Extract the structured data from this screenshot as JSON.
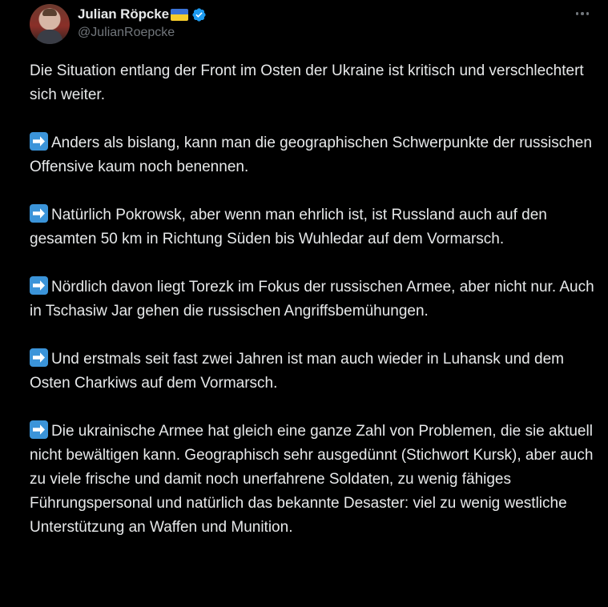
{
  "tweet": {
    "display_name": "Julian Röpcke",
    "handle": "@JulianRoepcke",
    "flag_icon": "ukraine-flag-icon",
    "verified_icon": "verified-badge-icon",
    "verified_color": "#1d9bf0",
    "more_icon": "more-options-icon"
  },
  "content": {
    "intro": "Die Situation entlang der Front im Osten der Ukraine ist kritisch und verschlechtert sich weiter.",
    "points": [
      "Anders als bislang, kann man die geographischen Schwerpunkte der russischen Offensive kaum noch benennen.",
      "Natürlich Pokrowsk, aber wenn man ehrlich ist, ist Russland auch auf den gesamten 50 km in Richtung Süden bis Wuhledar auf dem Vormarsch.",
      "Nördlich davon liegt Torezk im Fokus der russischen Armee, aber nicht nur. Auch in Tschasiw Jar gehen die russischen Angriffsbemühungen.",
      "Und erstmals seit fast zwei Jahren ist man auch wieder in Luhansk und dem Osten Charkiws auf dem Vormarsch.",
      "Die ukrainische Armee hat gleich eine ganze Zahl von Problemen, die sie aktuell nicht bewältigen kann. Geographisch sehr ausgedünnt (Stichwort Kursk), aber auch zu viele frische und damit noch unerfahrene Soldaten, zu wenig fähiges Führungspersonal und natürlich das bekannte Desaster: viel zu wenig westliche Unterstützung an Waffen und Munition."
    ],
    "bullet_icon": "right-arrow-emoji-icon"
  }
}
